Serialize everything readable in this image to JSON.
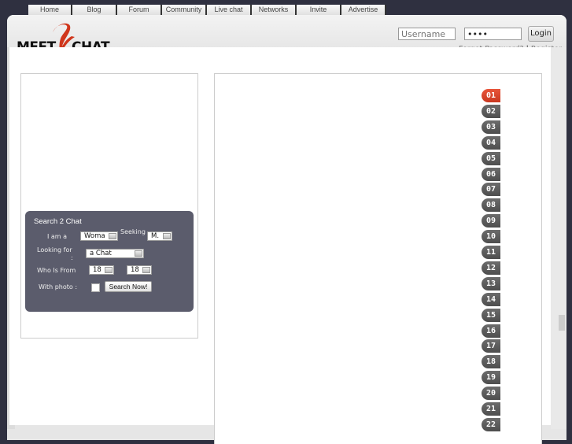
{
  "nav": {
    "tabs": [
      {
        "label": "Home"
      },
      {
        "label": "Blog"
      },
      {
        "label": "Forum"
      },
      {
        "label": "Community"
      },
      {
        "label": "Live chat"
      },
      {
        "label": "Networks"
      },
      {
        "label": "Invite"
      },
      {
        "label": "Advertise"
      }
    ]
  },
  "brand": {
    "left": "MEET",
    "right": "CHAT",
    "accent": "#d0361c"
  },
  "login": {
    "username_placeholder": "Username",
    "password_value": "••••",
    "login_label": "Login",
    "forgot_label": "Forgot Password?",
    "separator": "|",
    "register_label": "Register"
  },
  "search": {
    "title": "Search 2 Chat",
    "i_am_label": "I am a",
    "i_am_value": "Woma",
    "seeking_label": "Seeking",
    "seeking_value": "M.",
    "looking_for_label": "Looking for",
    "looking_for_colon": ":",
    "looking_for_value": "a Chat",
    "who_is_from_label": "Who Is From",
    "age_from_value": "18",
    "age_to_value": "18",
    "with_photo_label": "With photo :",
    "with_photo_checked": false,
    "submit_label": "Search Now!"
  },
  "pagination": {
    "active": "01",
    "pages": [
      "01",
      "02",
      "03",
      "04",
      "05",
      "06",
      "07",
      "08",
      "09",
      "10",
      "11",
      "12",
      "13",
      "14",
      "15",
      "16",
      "17",
      "18",
      "19",
      "20",
      "21",
      "22"
    ],
    "active_color": "#d9452b",
    "inactive_color": "#5c5c5c"
  }
}
